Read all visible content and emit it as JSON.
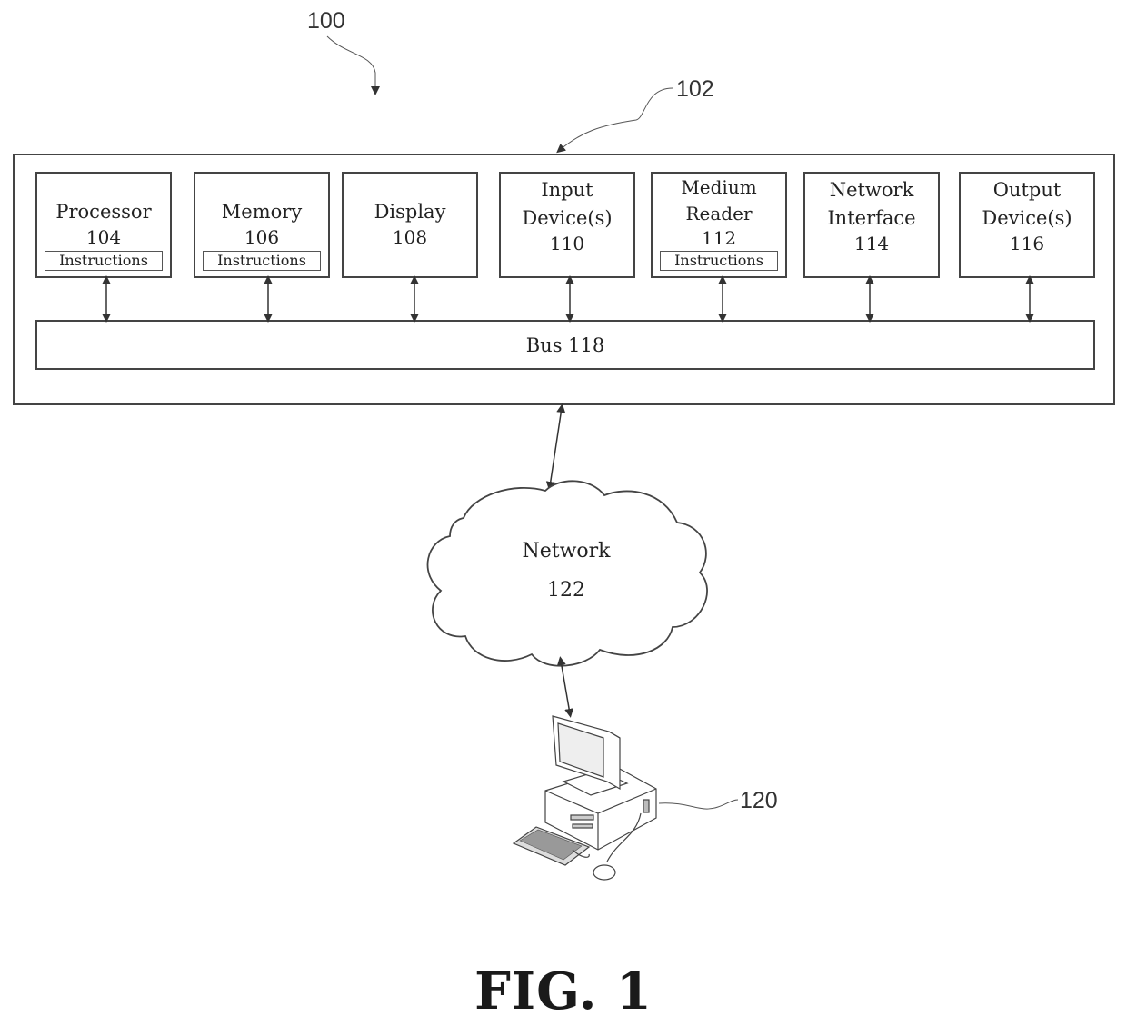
{
  "labels": {
    "system_ref": "100",
    "device_ref": "102",
    "client_ref": "120"
  },
  "components": [
    {
      "name": "Processor",
      "number": "104",
      "instructions": "Instructions"
    },
    {
      "name": "Memory",
      "number": "106",
      "instructions": "Instructions"
    },
    {
      "name": "Display",
      "number": "108"
    },
    {
      "name": "Input Device(s)",
      "number": "110"
    },
    {
      "name": "Medium Reader",
      "number": "112",
      "instructions": "Instructions"
    },
    {
      "name": "Network Interface",
      "number": "114"
    },
    {
      "name": "Output Device(s)",
      "number": "116"
    }
  ],
  "bus": {
    "label": "Bus 118"
  },
  "network": {
    "name": "Network",
    "number": "122"
  },
  "figure_caption": "FIG. 1"
}
